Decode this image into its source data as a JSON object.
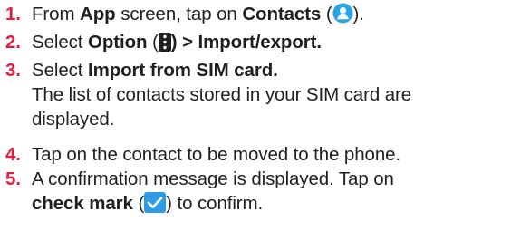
{
  "steps": [
    {
      "number": "1.",
      "parts": [
        "From ",
        "App",
        " screen, tap on ",
        "Contacts",
        " (",
        ")."
      ],
      "icon": "contacts-person-icon"
    },
    {
      "number": "2.",
      "parts": [
        "Select ",
        "Option",
        " (",
        ") > Import/export."
      ],
      "icon": "option-menu-icon"
    },
    {
      "number": "3.",
      "parts": [
        "Select ",
        "Import from SIM card."
      ],
      "lines": [
        "The list of contacts stored in your SIM card are",
        "displayed."
      ]
    },
    {
      "number": "4.",
      "parts": [
        "Tap on the contact to be moved to the phone."
      ]
    },
    {
      "number": "5.",
      "parts": [
        "A confirmation message is displayed. Tap on"
      ],
      "parts2": [
        "check mark",
        " (",
        ") to confirm."
      ],
      "icon": "check-mark-icon"
    }
  ],
  "colors": {
    "step_number": "#e51a3c",
    "contacts_icon": "#27a5e6",
    "checkmark_icon": "#2f9be6",
    "text": "#1f1f1f"
  }
}
